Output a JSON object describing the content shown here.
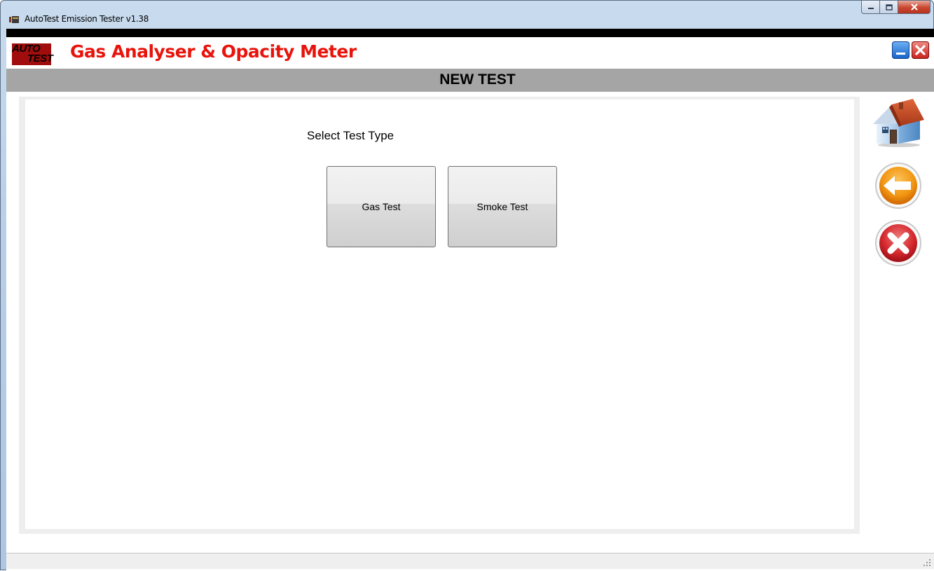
{
  "window": {
    "title": "AutoTest Emission Tester v1.38",
    "app_icon": "autotest-app-icon",
    "controls": [
      "minimize-icon",
      "maximize-icon",
      "close-icon"
    ]
  },
  "header": {
    "logo_line1": "AUTO",
    "logo_line2": "TEST",
    "title": "Gas Analyser & Opacity Meter",
    "title_color": "#e8140c",
    "minimize_icon": "minimize-icon",
    "close_icon": "close-icon"
  },
  "section": {
    "title": "NEW TEST"
  },
  "main": {
    "prompt": "Select Test Type",
    "buttons": [
      {
        "label": "Gas Test"
      },
      {
        "label": "Smoke Test"
      }
    ]
  },
  "side_nav": {
    "icons": [
      "home-icon",
      "back-arrow-icon",
      "cancel-icon"
    ]
  },
  "colors": {
    "section_bar": "#a5a5a5",
    "accent_red": "#e8140c",
    "back_orange": "#f39a12",
    "cancel_red": "#d4272c"
  }
}
